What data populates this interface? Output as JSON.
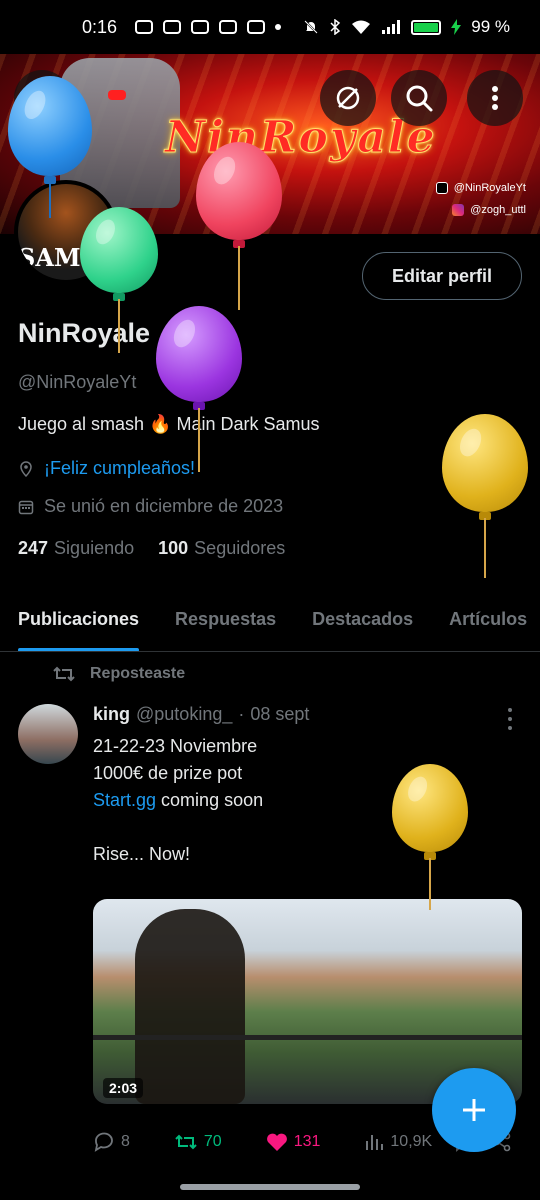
{
  "status_bar": {
    "time": "0:16",
    "battery_label": "99 %",
    "battery_level": 0.99,
    "battery_color": "#19d04b"
  },
  "banner": {
    "logo_text": "NinRoyale",
    "x_handle": "@NinRoyaleYt",
    "ig_handle": "@zogh_uttl"
  },
  "profile": {
    "edit_label": "Editar perfil",
    "name": "NinRoyale",
    "handle": "@NinRoyaleYt",
    "bio": "Juego al smash 🔥 Main Dark Samus",
    "birthday": "¡Feliz cumpleaños!",
    "joined": "Se unió en diciembre de 2023",
    "following_count": "247",
    "following_label": "Siguiendo",
    "followers_count": "100",
    "followers_label": "Seguidores",
    "avatar_text": "SAMUS"
  },
  "tabs": [
    {
      "label": "Publicaciones",
      "active": true
    },
    {
      "label": "Respuestas"
    },
    {
      "label": "Destacados"
    },
    {
      "label": "Artículos"
    }
  ],
  "post": {
    "repost_label": "Reposteaste",
    "author_name": "king",
    "author_handle": "@putoking_",
    "separator": "·",
    "date": "08 sept",
    "lines": [
      "21-22-23 Noviembre",
      "1000€ de prize pot"
    ],
    "link_text": "Start.gg",
    "link_suffix": " coming soon",
    "closing": "Rise... Now!",
    "video_duration": "2:03",
    "replies": "8",
    "reposts": "70",
    "likes": "131",
    "views": "10,9K"
  },
  "colors": {
    "accent": "#1d9bf0",
    "repost": "#00ba7c",
    "like": "#f91880",
    "muted": "#71767b"
  },
  "icons": [
    "back-arrow-icon",
    "no-grok-icon",
    "search-icon",
    "more-vert-icon",
    "location-icon",
    "calendar-icon",
    "repost-icon",
    "reply-icon",
    "like-icon",
    "views-icon",
    "bookmark-icon",
    "share-icon",
    "plus-icon",
    "balloon-icon"
  ]
}
